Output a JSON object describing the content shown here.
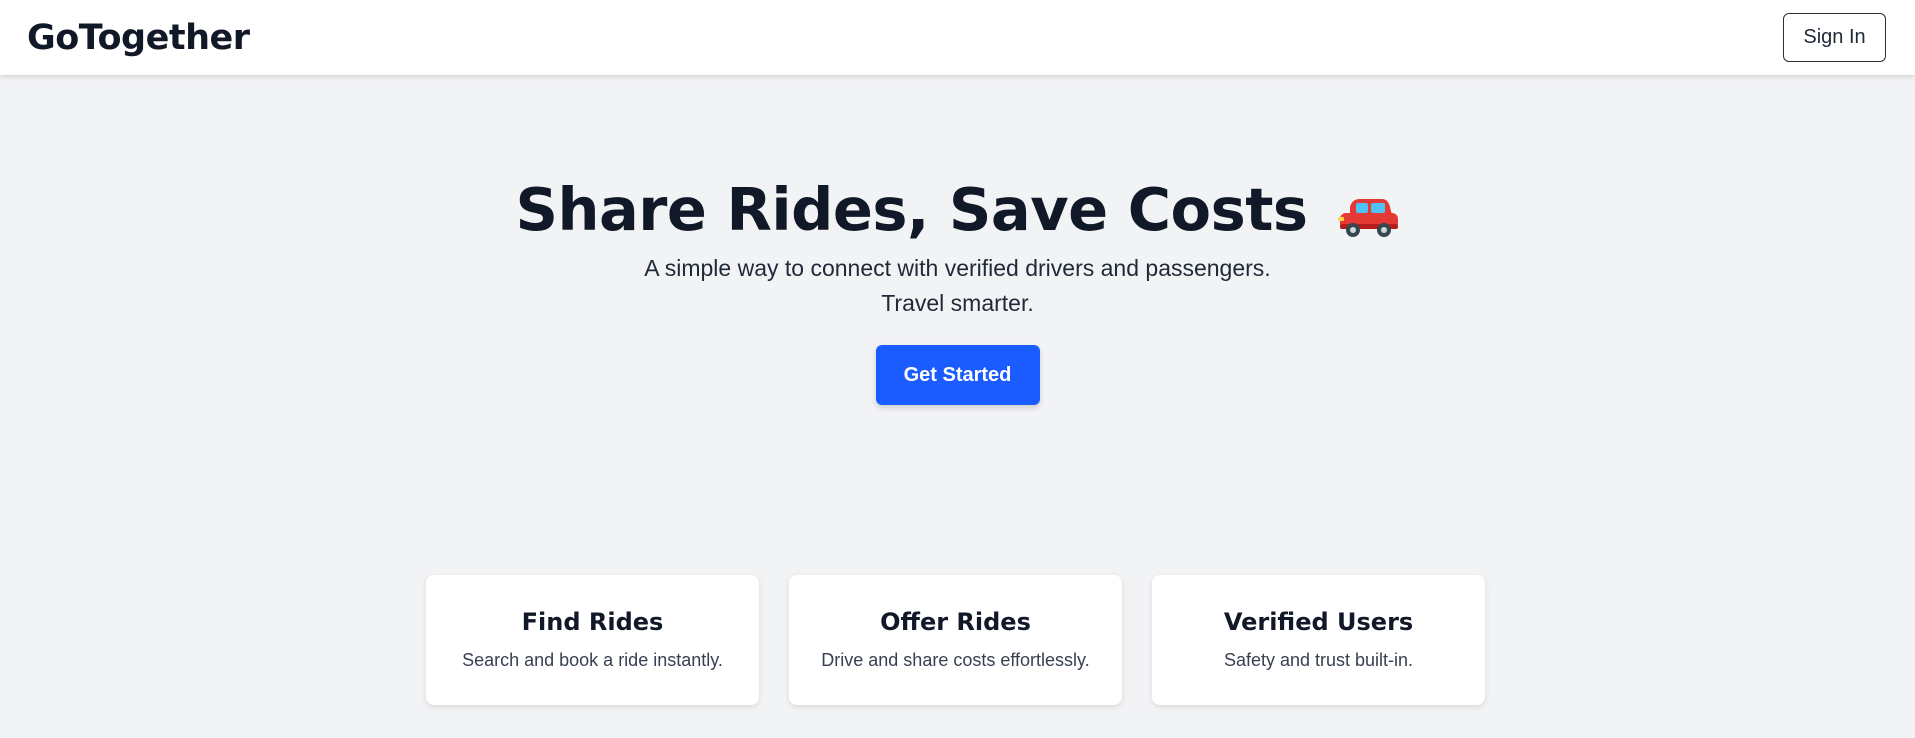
{
  "header": {
    "brand": "GoTogether",
    "sign_in_label": "Sign In"
  },
  "hero": {
    "title": "Share Rides, Save Costs",
    "icon": "car-icon",
    "subtitle_line1": "A simple way to connect with verified drivers and passengers.",
    "subtitle_line2": "Travel smarter.",
    "cta_label": "Get Started"
  },
  "features": [
    {
      "title": "Find Rides",
      "description": "Search and book a ride instantly."
    },
    {
      "title": "Offer Rides",
      "description": "Drive and share costs effortlessly."
    },
    {
      "title": "Verified Users",
      "description": "Safety and trust built-in."
    }
  ],
  "colors": {
    "primary": "#1a5cff",
    "background": "#f2f3f5",
    "text": "#111827",
    "car_body": "#e53935",
    "car_window": "#4fc3f7"
  }
}
